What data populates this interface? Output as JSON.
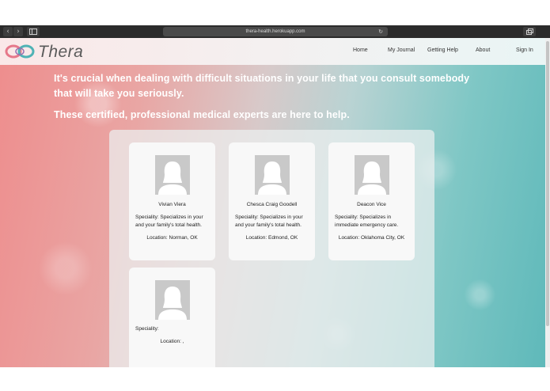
{
  "browser": {
    "url": "thera-health.herokuapp.com",
    "back_glyph": "‹",
    "forward_glyph": "›",
    "reload_glyph": "↻",
    "back_icon": "chevron-left-icon",
    "forward_icon": "chevron-right-icon",
    "sidebar_icon": "sidebar-icon",
    "tabs_icon": "tabs-icon"
  },
  "header": {
    "logo_text": "Thera",
    "nav": [
      "Home",
      "My Journal",
      "Getting Help",
      "About",
      "Sign In"
    ]
  },
  "intro": {
    "line1": "It's crucial when dealing with difficult situations in your life that you consult somebody",
    "line2": "that will take you seriously.",
    "line3": "These certified, professional medical experts are here to help."
  },
  "doctors": [
    {
      "name": "Vivian Viera",
      "spec_line1": "Speciality: Specializes in your",
      "spec_line2": "and your family's total health.",
      "location": "Location: Norman, OK"
    },
    {
      "name": "Chesca Craig Goodell",
      "spec_line1": "Speciality: Specializes in your",
      "spec_line2": "and your family's total health.",
      "location": "Location: Edmond, OK"
    },
    {
      "name": "Deacon Vice",
      "spec_line1": "Speciality: Specializes in",
      "spec_line2": "immediate emergency care.",
      "location": "Location: Oklahoma City, OK"
    },
    {
      "name": "",
      "spec_line1": "Speciality:",
      "spec_line2": "",
      "location": "Location: ,"
    }
  ],
  "colors": {
    "gradient_left": "#ee8d8d",
    "gradient_right": "#5fb9ba",
    "logo_pink": "#e6788a",
    "logo_teal": "#4fb3b5"
  }
}
